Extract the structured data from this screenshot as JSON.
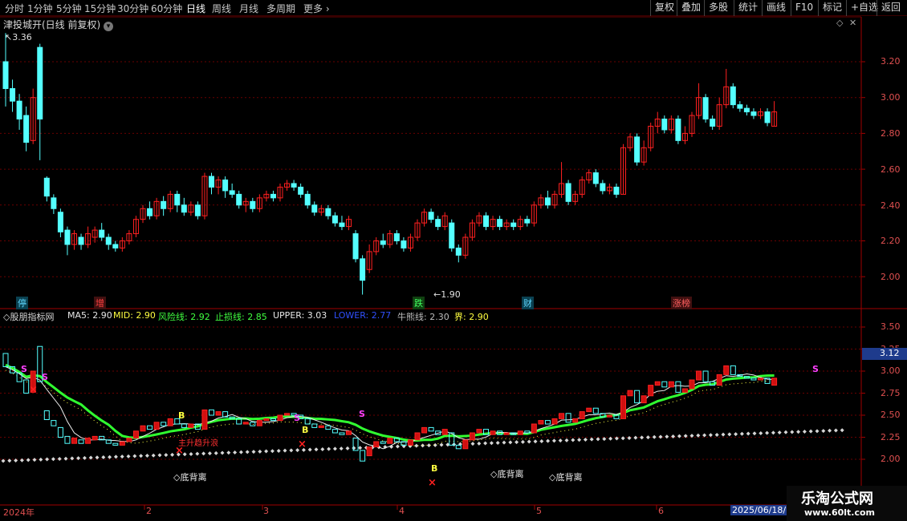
{
  "toolbar": {
    "periods": [
      "分时",
      "1分钟",
      "5分钟",
      "15分钟",
      "30分钟",
      "60分钟",
      "日线",
      "周线",
      "月线",
      "多周期",
      "更多"
    ],
    "active_period": "日线",
    "right_buttons": [
      "复权",
      "叠加",
      "多股",
      "统计",
      "画线",
      "F10",
      "标记",
      "+自选",
      "返回"
    ]
  },
  "main_chart": {
    "title": "津投城开(日线 前复权)",
    "high_label": "3.36",
    "low_label": "1.90",
    "y_ticks": [
      "3.20",
      "3.00",
      "2.80",
      "2.60",
      "2.40",
      "2.20",
      "2.00"
    ],
    "tags": [
      {
        "text": "停",
        "color": "#5fd7ff"
      },
      {
        "text": "增",
        "color": "#ff4040"
      },
      {
        "text": "跌",
        "color": "#40ff60"
      },
      {
        "text": "财",
        "color": "#5fd7ff"
      },
      {
        "text": "涨榜",
        "color": "#ff4040"
      }
    ]
  },
  "indicator": {
    "name": "股朋指标网",
    "items": [
      {
        "label": "MA5:",
        "value": "2.90",
        "color": "#e6e6e6"
      },
      {
        "label": "MID:",
        "value": "2.90",
        "color": "#ffff40"
      },
      {
        "label": "风险线:",
        "value": "2.92",
        "color": "#40ff40"
      },
      {
        "label": "止损线:",
        "value": "2.85",
        "color": "#40ff40"
      },
      {
        "label": "UPPER:",
        "value": "3.03",
        "color": "#e6e6e6"
      },
      {
        "label": "LOWER:",
        "value": "2.77",
        "color": "#3050ff"
      },
      {
        "label": "牛熊线:",
        "value": "2.30",
        "color": "#bdbdbd"
      },
      {
        "label": "界:",
        "value": "2.90",
        "color": "#ffff40"
      }
    ],
    "y_ticks": [
      "3.50",
      "3.25",
      "3.00",
      "2.75",
      "2.50",
      "2.25",
      "2.00"
    ],
    "current_value": "3.12",
    "signals": {
      "divergence": "◇底背离",
      "trend_text": "主升趋升浪",
      "buy": "B",
      "sell": "S",
      "cross": "×"
    }
  },
  "x_axis": {
    "labels": [
      "2024年",
      "2",
      "3",
      "4",
      "5",
      "6"
    ],
    "cursor_date": "2025/06/18/"
  },
  "watermark": {
    "line1": "乐淘公式网",
    "line2": "www.60lt.com"
  }
}
